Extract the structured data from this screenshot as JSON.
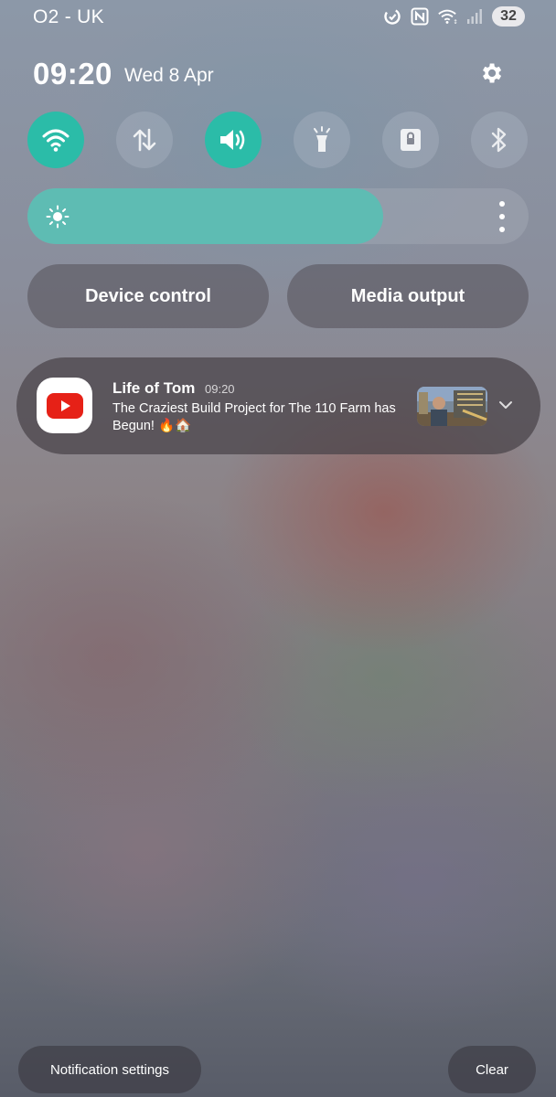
{
  "status_bar": {
    "carrier": "O2 - UK",
    "icons": [
      "data-saver-icon",
      "nfc-icon",
      "wifi-icon",
      "signal-icon"
    ],
    "battery": "32"
  },
  "header": {
    "time": "09:20",
    "date": "Wed 8 Apr",
    "settings_icon": "gear-icon"
  },
  "quick_settings": [
    {
      "name": "wifi",
      "icon": "wifi-icon",
      "active": true
    },
    {
      "name": "mobile-data",
      "icon": "data-arrows-icon",
      "active": false
    },
    {
      "name": "sound",
      "icon": "speaker-icon",
      "active": true
    },
    {
      "name": "flashlight",
      "icon": "flashlight-icon",
      "active": false
    },
    {
      "name": "secure-folder",
      "icon": "lock-icon",
      "active": false
    },
    {
      "name": "bluetooth",
      "icon": "bluetooth-icon",
      "active": false
    }
  ],
  "brightness": {
    "level": 0.71,
    "accent": "#5ebcb3"
  },
  "controls": {
    "device_control": "Device control",
    "media_output": "Media output"
  },
  "notification": {
    "app_icon": "youtube-icon",
    "title": "Life of Tom",
    "time": "09:20",
    "body": "The Craziest Build Project for The 110 Farm has Begun! 🔥🏠"
  },
  "footer": {
    "notification_settings": "Notification settings",
    "clear": "Clear"
  },
  "colors": {
    "accent": "#2bbca8",
    "youtube_red": "#e62117"
  }
}
